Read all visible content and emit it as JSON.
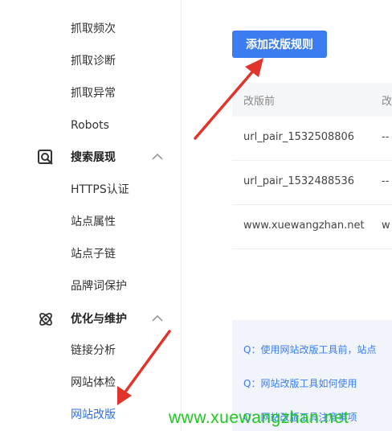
{
  "sidebar": {
    "top_cut": "抓取...",
    "items_a": [
      "抓取频次",
      "抓取诊断",
      "抓取异常",
      "Robots"
    ],
    "group_search": "搜索展现",
    "items_b": [
      "HTTPS认证",
      "站点属性",
      "站点子链",
      "品牌词保护"
    ],
    "group_optimize": "优化与维护",
    "items_c": [
      "链接分析",
      "网站体检",
      "网站改版"
    ]
  },
  "main": {
    "add_button": "添加改版规则",
    "table": {
      "headers": [
        "改版前",
        "改"
      ],
      "rows": [
        [
          "url_pair_1532508806",
          "--"
        ],
        [
          "url_pair_1532488536",
          "--"
        ],
        [
          "www.xuewangzhan.net",
          "w"
        ]
      ]
    },
    "faq": [
      "Q：使用网站改版工具前，站点",
      "Q：网站改版工具如何使用",
      "Q：网站改版工具注意事项"
    ]
  },
  "watermark": "www.xuewangzhan.net",
  "colors": {
    "accent": "#3b7cf1",
    "arrow": "#e0332a",
    "watermark": "#1ec81e"
  }
}
